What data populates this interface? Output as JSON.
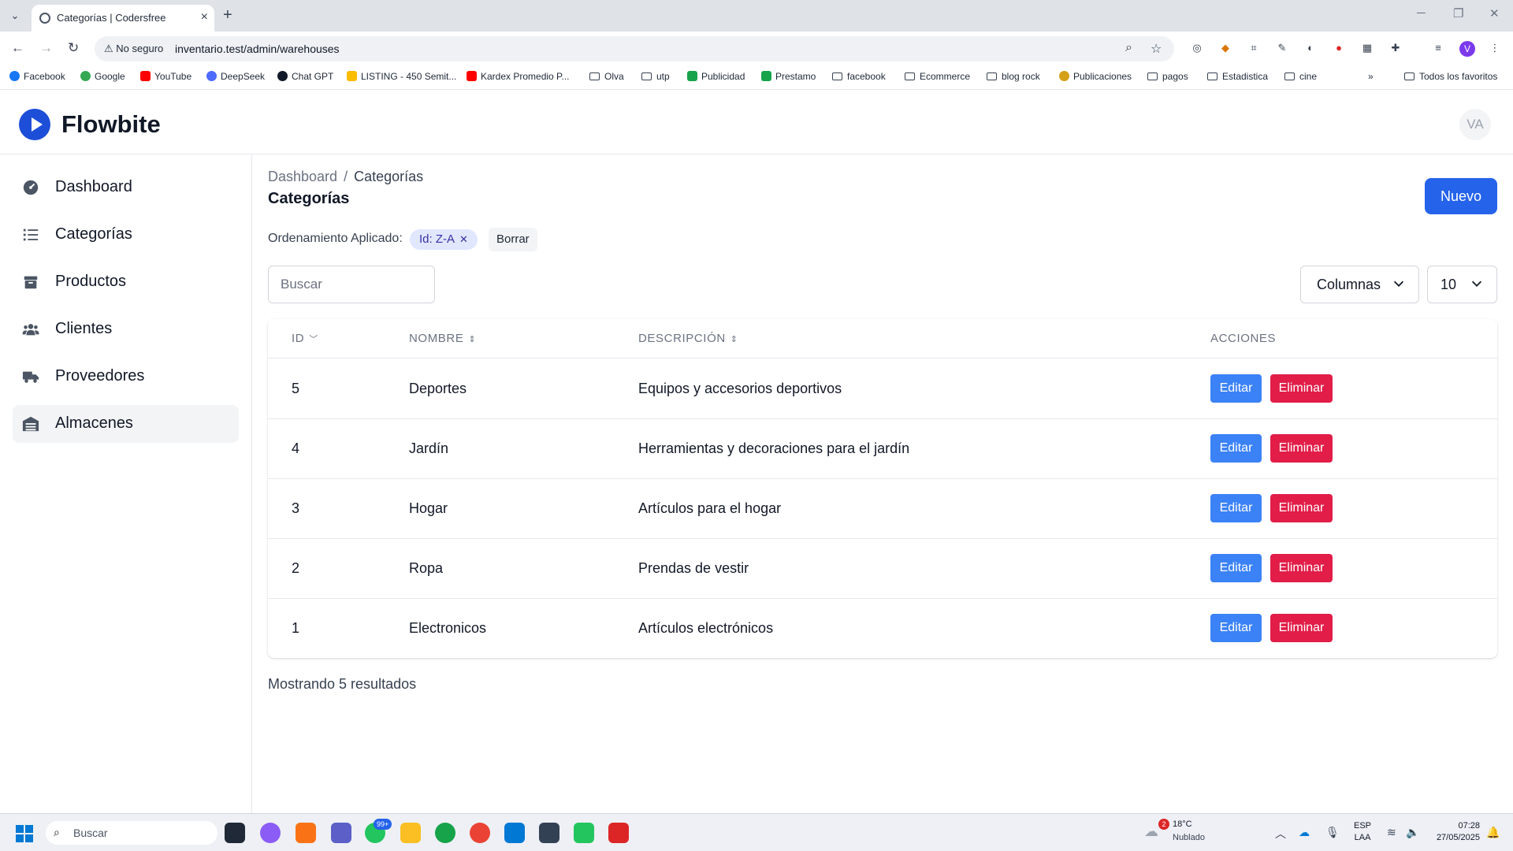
{
  "browser": {
    "tab_title": "Categorías | Codersfree",
    "security_label": "No seguro",
    "url": "inventario.test/admin/warehouses",
    "profile_initial": "V",
    "bookmarks": [
      "Facebook",
      "Google",
      "YouTube",
      "DeepSeek",
      "Chat GPT",
      "LISTING - 450 Semit...",
      "Kardex Promedio P...",
      "Olva",
      "utp",
      "Publicidad",
      "Prestamo",
      "facebook",
      "Ecommerce",
      "blog rock",
      "Publicaciones",
      "pagos",
      "Estadistica",
      "cine"
    ],
    "all_bookmarks": "Todos los favoritos"
  },
  "app": {
    "brand": "Flowbite",
    "user_initials": "VA"
  },
  "sidebar": {
    "items": [
      {
        "label": "Dashboard",
        "icon": "gauge-icon"
      },
      {
        "label": "Categorías",
        "icon": "list-icon"
      },
      {
        "label": "Productos",
        "icon": "box-icon"
      },
      {
        "label": "Clientes",
        "icon": "users-icon"
      },
      {
        "label": "Proveedores",
        "icon": "truck-icon"
      },
      {
        "label": "Almacenes",
        "icon": "warehouse-icon",
        "active": true
      }
    ]
  },
  "page": {
    "breadcrumb": [
      "Dashboard",
      "Categorías"
    ],
    "title": "Categorías",
    "new_button": "Nuevo",
    "sort_label": "Ordenamiento Aplicado:",
    "sort_chip": "Id: Z-A",
    "clear_button": "Borrar",
    "search_placeholder": "Buscar",
    "columns_button": "Columnas",
    "per_page": "10",
    "results_text": "Mostrando 5 resultados"
  },
  "table": {
    "headers": [
      "ID",
      "NOMBRE",
      "DESCRIPCIÓN",
      "ACCIONES"
    ],
    "edit_label": "Editar",
    "delete_label": "Eliminar",
    "rows": [
      {
        "id": "5",
        "name": "Deportes",
        "description": "Equipos y accesorios deportivos"
      },
      {
        "id": "4",
        "name": "Jardín",
        "description": "Herramientas y decoraciones para el jardín"
      },
      {
        "id": "3",
        "name": "Hogar",
        "description": "Artículos para el hogar"
      },
      {
        "id": "2",
        "name": "Ropa",
        "description": "Prendas de vestir"
      },
      {
        "id": "1",
        "name": "Electronicos",
        "description": "Artículos electrónicos"
      }
    ]
  },
  "taskbar": {
    "search_text": "Buscar",
    "badge": "99+",
    "weather_temp": "18°C",
    "weather_cond": "Nublado",
    "weather_alerts": "2",
    "lang_1": "ESP",
    "lang_2": "LAA",
    "time": "07:28",
    "date": "27/05/2025"
  },
  "colors": {
    "primary": "#2563eb",
    "edit": "#3b82f6",
    "delete": "#e11d48",
    "chip_bg": "#e0e7ff"
  }
}
